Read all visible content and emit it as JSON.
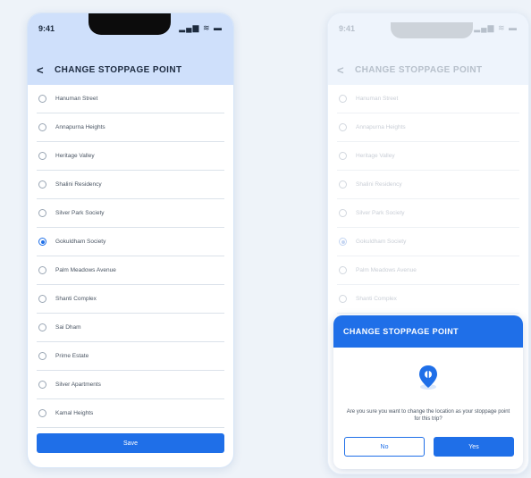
{
  "status": {
    "time": "9:41",
    "icons": "▂▄▆ ≋ ▬"
  },
  "header": {
    "back_glyph": "<",
    "title": "CHANGE STOPPAGE POINT"
  },
  "stops": [
    "Hanuman Street",
    "Annapurna Heights",
    "Heritage Valley",
    "Shalini Residency",
    "Silver Park Society",
    "Gokuldham Society",
    "Palm Meadows Avenue",
    "Shanti Complex",
    "Sai Dham",
    "Prime Estate",
    "Silver Apartments",
    "Kamal Heights"
  ],
  "selected_index": 5,
  "save_label": "Save",
  "modal": {
    "title": "CHANGE STOPPAGE POINT",
    "message": "Are you sure you want to change the location as your stoppage point for this trip?",
    "no_label": "No",
    "yes_label": "Yes",
    "icon": "location-pin-icon"
  },
  "colors": {
    "accent": "#1f6fe8",
    "header_bg": "#cfe0fb"
  }
}
